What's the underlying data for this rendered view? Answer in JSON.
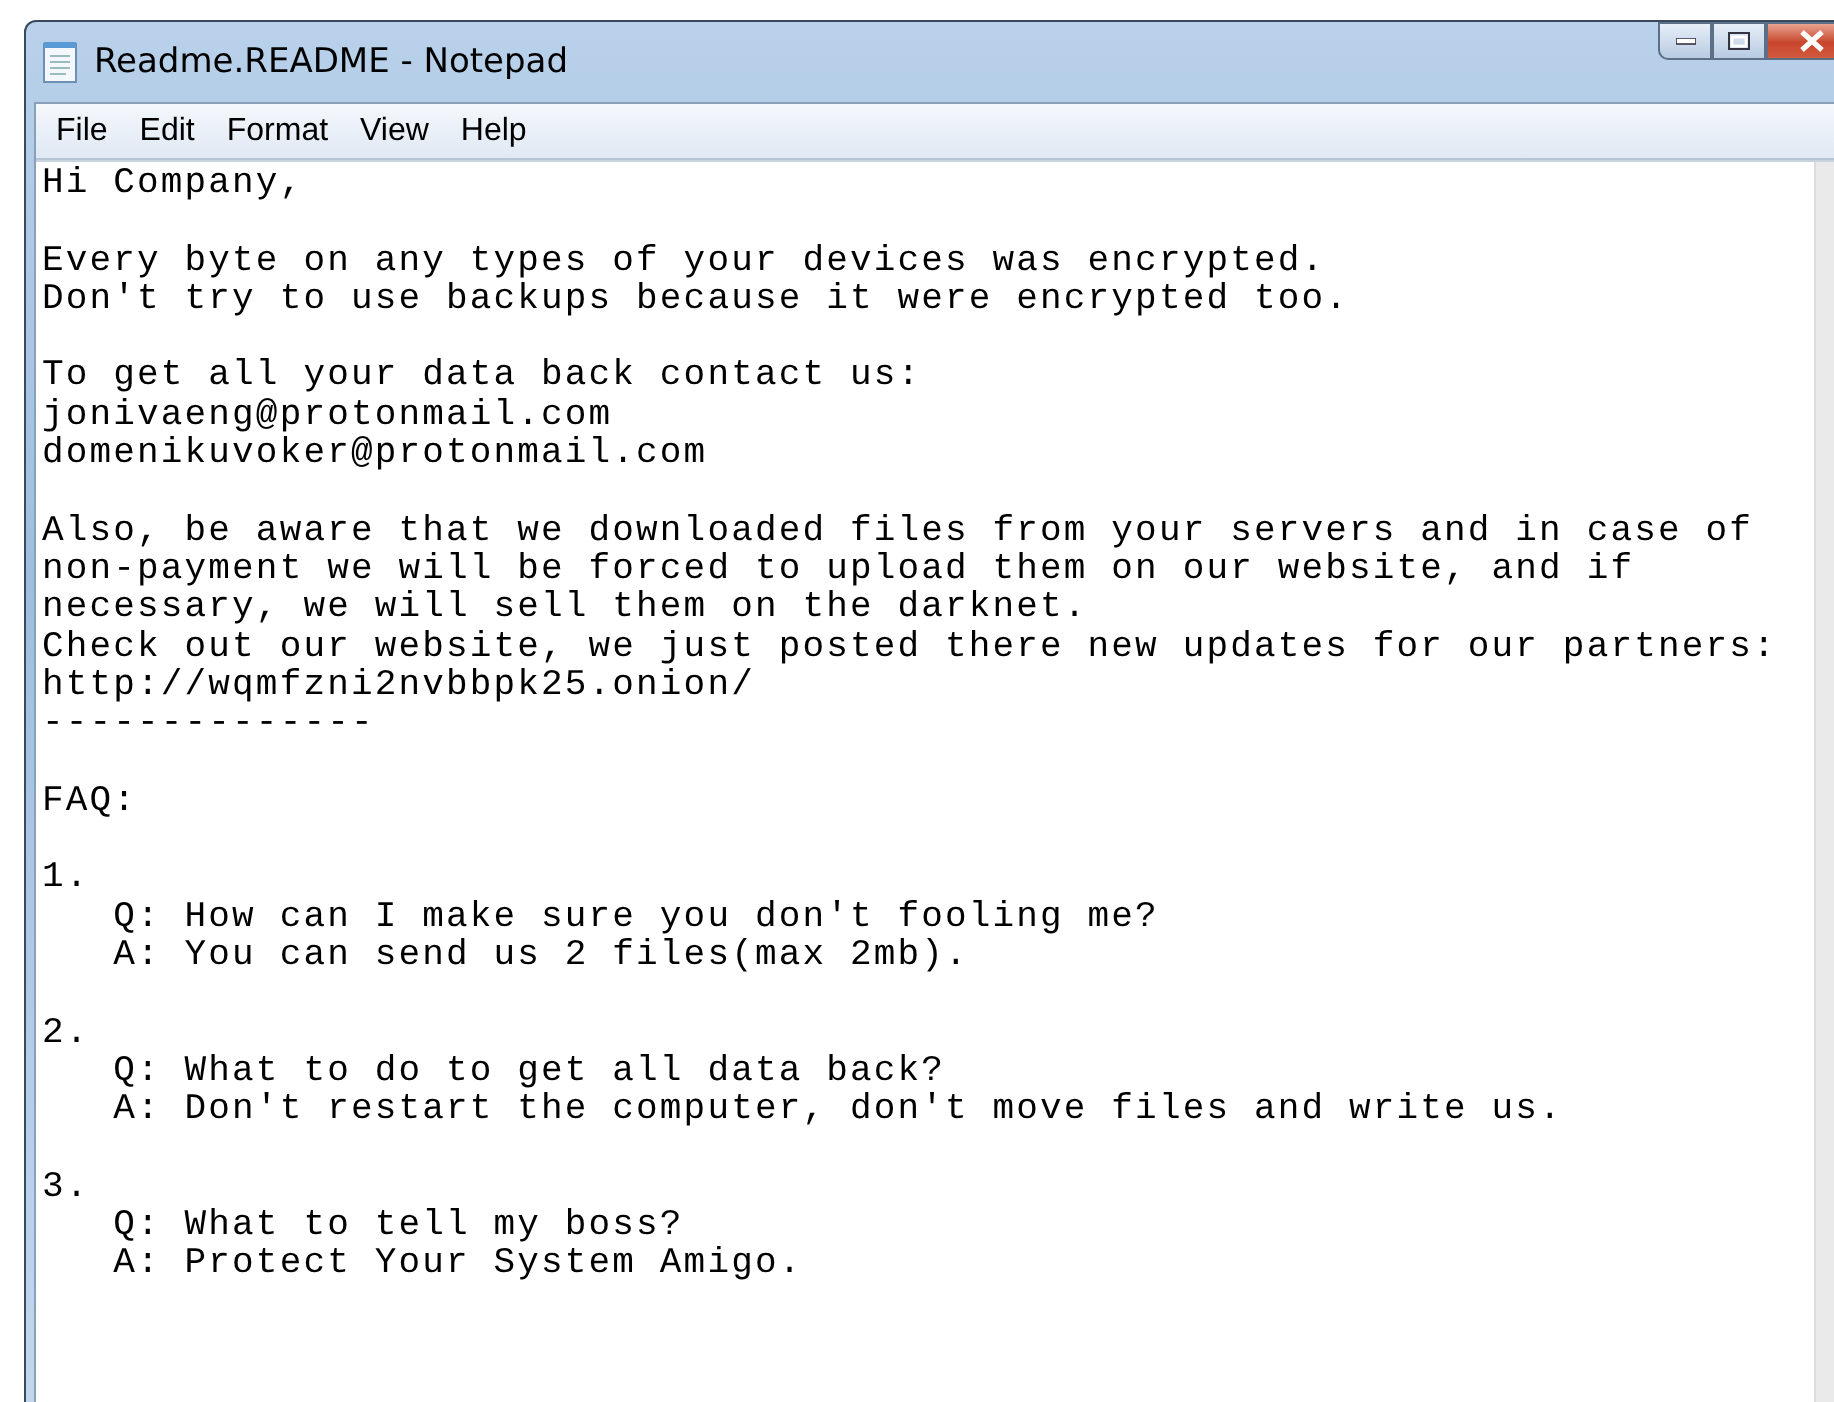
{
  "window": {
    "title": "Readme.README - Notepad"
  },
  "menu": [
    "File",
    "Edit",
    "Format",
    "View",
    "Help"
  ],
  "document": {
    "paragraphs": [
      [
        "Hi Company,"
      ],
      [
        "Every byte on any types of your devices was encrypted.",
        "Don't try to use backups because it were encrypted too."
      ],
      [
        "To get all your data back contact us:",
        "jonivaeng@protonmail.com",
        "domenikuvoker@protonmail.com"
      ],
      [
        "Also, be aware that we downloaded files from your servers and in case of",
        "non-payment we will be forced to upload them on our website, and if",
        "necessary, we will sell them on the darknet.",
        "Check out our website, we just posted there new updates for our partners:",
        "http://wqmfzni2nvbbpk25.onion/",
        "--------------"
      ],
      [
        "FAQ:"
      ],
      [
        "1.",
        "   Q: How can I make sure you don't fooling me?",
        "   A: You can send us 2 files(max 2mb)."
      ],
      [
        "2.",
        "   Q: What to do to get all data back?",
        "   A: Don't restart the computer, don't move files and write us."
      ],
      [
        "3.",
        "   Q: What to tell my boss?",
        "   A: Protect Your System Amigo."
      ]
    ]
  }
}
